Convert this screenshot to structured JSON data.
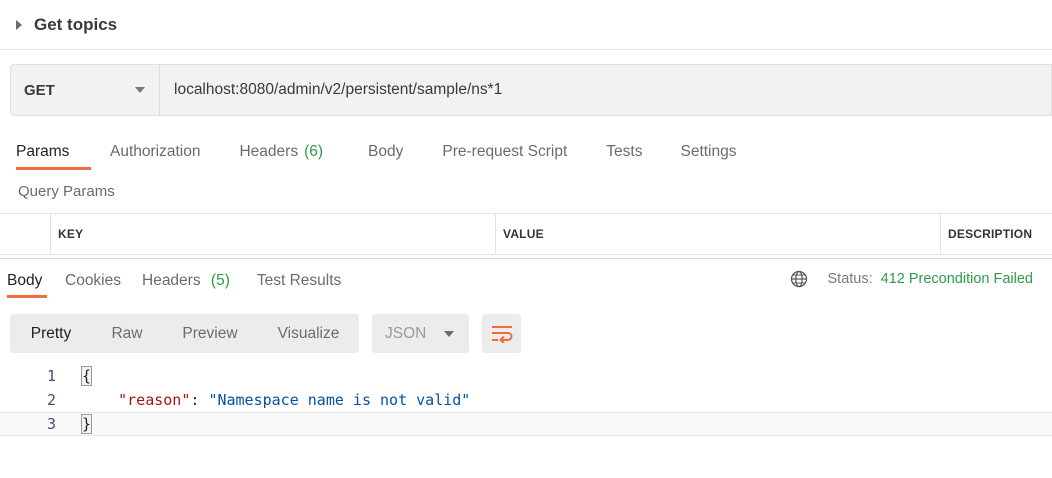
{
  "request": {
    "title": "Get topics",
    "method": "GET",
    "url": "localhost:8080/admin/v2/persistent/sample/ns*1"
  },
  "request_tabs": [
    {
      "label": "Params",
      "count": ""
    },
    {
      "label": "Authorization",
      "count": ""
    },
    {
      "label": "Headers",
      "count": "(6)"
    },
    {
      "label": "Body",
      "count": ""
    },
    {
      "label": "Pre-request Script",
      "count": ""
    },
    {
      "label": "Tests",
      "count": ""
    },
    {
      "label": "Settings",
      "count": ""
    }
  ],
  "query_params": {
    "label": "Query Params",
    "columns": [
      "KEY",
      "VALUE",
      "DESCRIPTION"
    ]
  },
  "response_tabs": [
    {
      "label": "Body",
      "count": ""
    },
    {
      "label": "Cookies",
      "count": ""
    },
    {
      "label": "Headers",
      "count": "(5)"
    },
    {
      "label": "Test Results",
      "count": ""
    }
  ],
  "status": {
    "label": "Status:",
    "value": "412 Precondition Failed",
    "icon": "globe-icon"
  },
  "view_modes": [
    "Pretty",
    "Raw",
    "Preview",
    "Visualize"
  ],
  "format": "JSON",
  "response_body": {
    "line_numbers": [
      "1",
      "2",
      "3"
    ],
    "open_brace": "{",
    "key": "\"reason\"",
    "colon": ": ",
    "value": "\"Namespace name is not valid\"",
    "close_brace": "}"
  },
  "colors": {
    "accent": "#f26b3a",
    "success": "#2d9c4a",
    "json_key": "#a31515",
    "json_string": "#0451a5"
  }
}
